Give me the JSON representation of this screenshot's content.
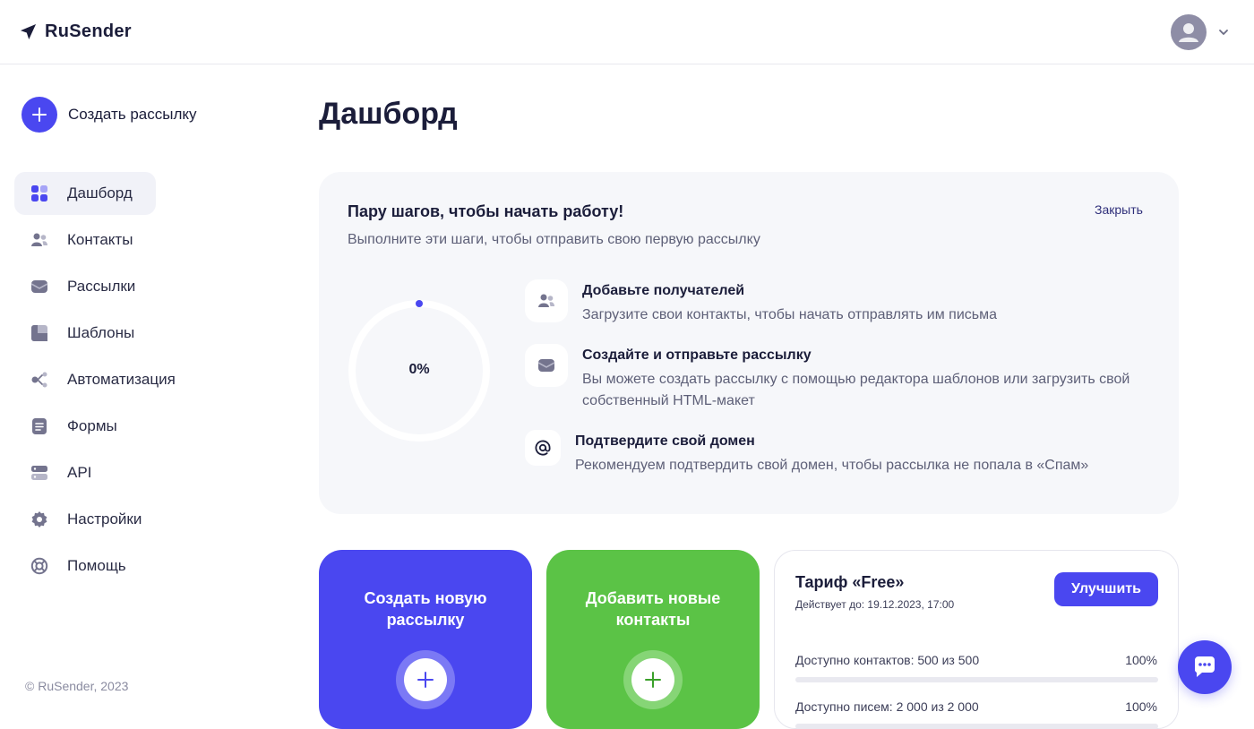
{
  "app": {
    "brand": "RuSender",
    "accent_color": "#4a47f0",
    "green_color": "#5bc346"
  },
  "header": {
    "avatar_icon": "user-icon",
    "menu_icon": "chevron-down-icon"
  },
  "sidebar": {
    "create_label": "Создать рассылку",
    "items": [
      {
        "label": "Дашборд",
        "icon": "dashboard-icon",
        "active": true
      },
      {
        "label": "Контакты",
        "icon": "contacts-icon"
      },
      {
        "label": "Рассылки",
        "icon": "mailbox-icon"
      },
      {
        "label": "Шаблоны",
        "icon": "templates-icon"
      },
      {
        "label": "Автоматизация",
        "icon": "automation-icon"
      },
      {
        "label": "Формы",
        "icon": "forms-icon"
      },
      {
        "label": "API",
        "icon": "api-icon"
      },
      {
        "label": "Настройки",
        "icon": "settings-gear-icon"
      },
      {
        "label": "Помощь",
        "icon": "help-lifebuoy-icon"
      }
    ],
    "copyright": "© RuSender, 2023"
  },
  "main": {
    "title": "Дашборд",
    "onboarding": {
      "title": "Пару шагов, чтобы начать работу!",
      "subtitle": "Выполните эти шаги, чтобы отправить свою первую рассылку",
      "close_label": "Закрыть",
      "progress": 0,
      "progress_label": "0%",
      "steps": [
        {
          "title": "Добавьте получателей",
          "desc": "Загрузите свои контакты, чтобы начать отправлять им письма",
          "icon": "contacts-icon"
        },
        {
          "title": "Создайте и отправьте рассылку",
          "desc": "Вы можете создать рассылку с помощью редактора шаблонов или загрузить свой собственный HTML-макет",
          "icon": "mailbox-icon"
        },
        {
          "title": "Подтвердите свой домен",
          "desc": "Рекомендуем подтвердить свой домен, чтобы рассылка не попала в «Спам»",
          "icon": "at-sign-icon"
        }
      ]
    },
    "cards": {
      "create_campaign": "Создать новую рассылку",
      "add_contacts": "Добавить новые контакты"
    },
    "tariff": {
      "title": "Тариф «Free»",
      "valid_until": "Действует до: 19.12.2023, 17:00",
      "upgrade_label": "Улучшить",
      "limits": [
        {
          "label": "Доступно контактов: 500 из 500",
          "percent_label": "100%",
          "fraction": 1.0
        },
        {
          "label": "Доступно писем: 2 000 из 2 000",
          "percent_label": "100%",
          "fraction": 1.0
        }
      ]
    },
    "chat_icon": "chat-bubble-icon"
  }
}
